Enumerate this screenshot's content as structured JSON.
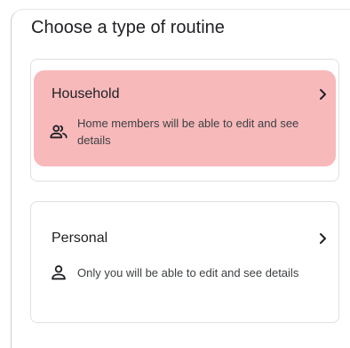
{
  "page": {
    "title": "Choose a type of routine"
  },
  "options": {
    "household": {
      "label": "Household",
      "description": "Home members will be able to edit and see details",
      "icon": "people-icon",
      "highlight_color": "#f8b9bb"
    },
    "personal": {
      "label": "Personal",
      "description": "Only you will be able to edit and see details",
      "icon": "person-icon"
    }
  }
}
